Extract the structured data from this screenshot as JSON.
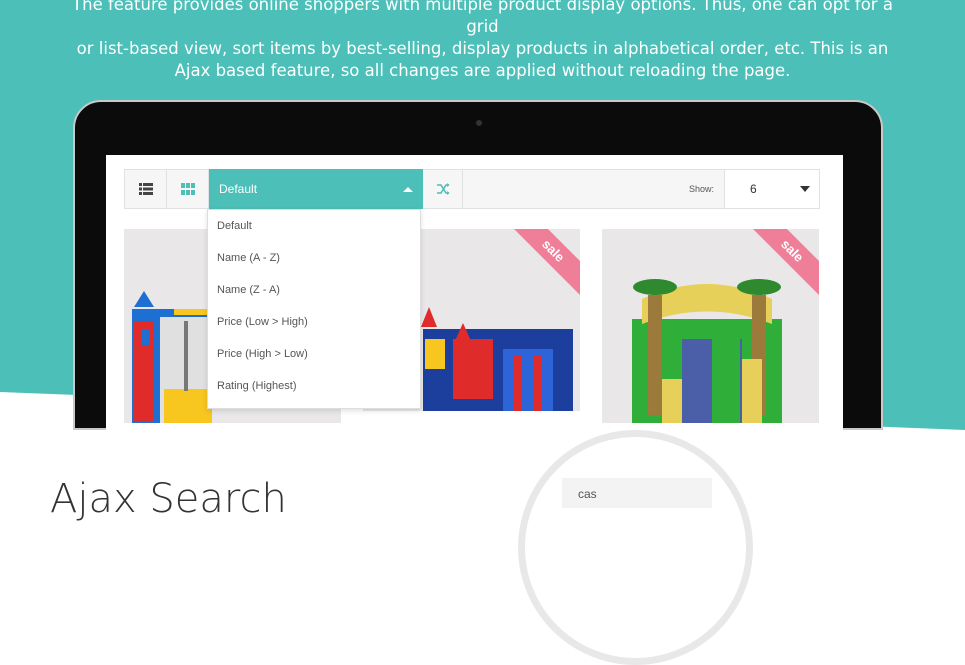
{
  "intro": {
    "line1": "The feature provides online shoppers with multiple product display options. Thus, one can opt for a grid",
    "line2": "or list-based view, sort items by best-selling, display products in alphabetical order, etc. This is an",
    "line3": "Ajax based feature, so all changes are applied without reloading the page."
  },
  "toolbar": {
    "list_view_icon": "list-icon",
    "grid_view_icon": "grid-icon",
    "sort_selected": "Default",
    "shuffle_icon": "shuffle-icon",
    "show_label": "Show:",
    "show_value": "6"
  },
  "sort_options": [
    "Default",
    "Name (A - Z)",
    "Name (Z - A)",
    "Price (Low > High)",
    "Price (High > Low)",
    "Rating (Highest)"
  ],
  "products": [
    {
      "badge": ""
    },
    {
      "badge": "sale"
    },
    {
      "badge": "sale"
    }
  ],
  "section": {
    "title": "Ajax Search",
    "search_text": "cas"
  },
  "colors": {
    "accent": "#4bbfb8",
    "sale_badge": "#ef7f99"
  }
}
